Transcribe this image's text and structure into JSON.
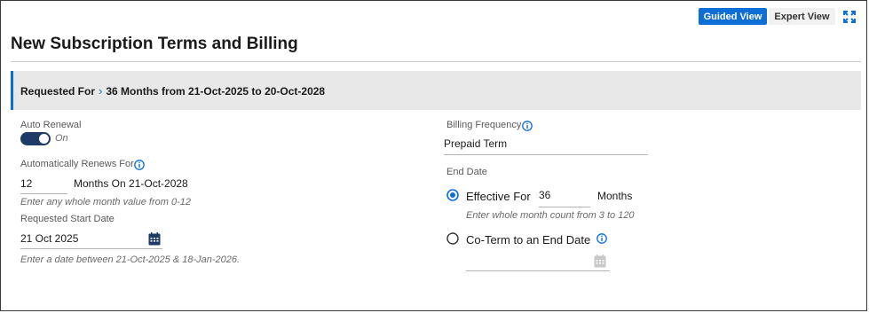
{
  "header": {
    "guided_view_label": "Guided View",
    "expert_view_label": "Expert View",
    "title": "New Subscription Terms and Billing"
  },
  "banner": {
    "label": "Requested For",
    "value": "36 Months from 21-Oct-2025 to 20-Oct-2028"
  },
  "left": {
    "auto_renewal_label": "Auto Renewal",
    "auto_renewal_state": "On",
    "renews_for_label": "Automatically Renews For",
    "renews_for_value": "12",
    "renews_for_suffix": "Months On 21-Oct-2028",
    "renews_for_hint": "Enter any whole month value from 0-12",
    "start_date_label": "Requested Start Date",
    "start_date_value": "21 Oct 2025",
    "start_date_hint": "Enter a date between 21-Oct-2025 & 18-Jan-2026."
  },
  "right": {
    "billing_frequency_label": "Billing Frequency",
    "billing_frequency_value": "Prepaid Term",
    "end_date_label": "End Date",
    "effective_for_label": "Effective For",
    "effective_for_value": "36",
    "effective_for_suffix": "Months",
    "effective_for_hint": "Enter whole month count from 3 to 120",
    "coterm_label": "Co-Term to an End Date",
    "coterm_value": ""
  },
  "colors": {
    "accent": "#0d6fd6",
    "toggle_on": "#1e3a66",
    "banner_bg": "#e8e8e8"
  }
}
